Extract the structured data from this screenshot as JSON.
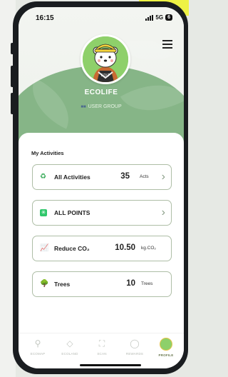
{
  "status_bar": {
    "time": "16:15",
    "network": "5G",
    "battery": "6"
  },
  "profile": {
    "name": "ECOLIFE",
    "group": "USER GROUP",
    "edit_label": "EDIT"
  },
  "activities": {
    "title": "My Activities",
    "cards": [
      {
        "icon": "recycle-icon",
        "label": "All Activities",
        "value": "35",
        "unit": "Acts",
        "has_chevron": true
      },
      {
        "icon": "points-star-icon",
        "label": "ALL POINTS",
        "value": "",
        "unit": "",
        "has_chevron": true
      },
      {
        "icon": "chart-icon",
        "label": "Reduce CO₂",
        "value": "10.50",
        "unit": "kg.CO₂",
        "has_chevron": false
      },
      {
        "icon": "tree-icon",
        "label": "Trees",
        "value": "10",
        "unit": "Trees",
        "has_chevron": false
      }
    ]
  },
  "bottom_nav": [
    {
      "label": "ECOMAP",
      "icon": "map-pin-icon",
      "active": false
    },
    {
      "label": "ECOLAND",
      "icon": "land-icon",
      "active": false
    },
    {
      "label": "SCAN",
      "icon": "scan-icon",
      "active": false
    },
    {
      "label": "REWARDS",
      "icon": "tag-icon",
      "active": false
    },
    {
      "label": "PROFILE",
      "icon": "profile-avatar-icon",
      "active": true
    }
  ],
  "colors": {
    "accent_green": "#86b587",
    "card_border": "#aebea6",
    "yellow_accent": "#eef244"
  }
}
